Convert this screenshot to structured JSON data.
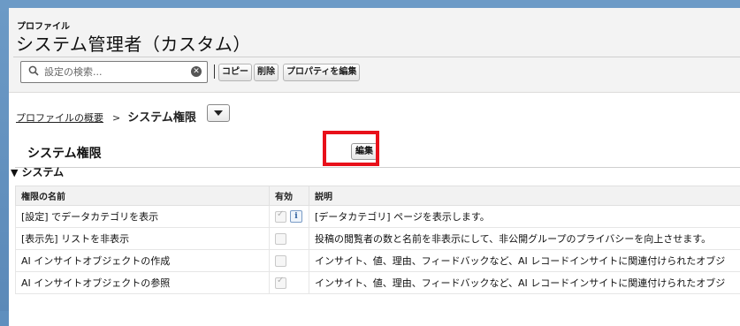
{
  "header": {
    "kicker": "プロファイル",
    "title": "システム管理者（カスタム）"
  },
  "toolbar": {
    "search_placeholder": "設定の検索...",
    "copy_label": "コピー",
    "delete_label": "削除",
    "edit_properties_label": "プロパティを編集"
  },
  "breadcrumb": {
    "link": "プロファイルの概要",
    "arrow": ">",
    "current": "システム権限"
  },
  "section": {
    "title": "システム権限",
    "edit_label": "編集",
    "subsection_marker": "▼",
    "subsection_title": "システム"
  },
  "table": {
    "headers": [
      "権限の名前",
      "有効",
      "説明"
    ],
    "rows": [
      {
        "name": "[設定] でデータカテゴリを表示",
        "enabled": true,
        "has_info": true,
        "info_icon": "i",
        "description": "[データカテゴリ] ページを表示します。"
      },
      {
        "name": "[表示先] リストを非表示",
        "enabled": false,
        "has_info": false,
        "description": "投稿の閲覧者の数と名前を非表示にして、非公開グループのプライバシーを向上させます。"
      },
      {
        "name": "AI インサイトオブジェクトの作成",
        "enabled": false,
        "has_info": false,
        "description": "インサイト、値、理由、フィードバックなど、AI レコードインサイトに関連付けられたオブジ"
      },
      {
        "name": "AI インサイトオブジェクトの参照",
        "enabled": true,
        "has_info": false,
        "description": "インサイト、値、理由、フィードバックなど、AI レコードインサイトに関連付けられたオブジ"
      }
    ]
  },
  "colors": {
    "highlight": "#e8101a",
    "background": "#5f8fbe"
  }
}
